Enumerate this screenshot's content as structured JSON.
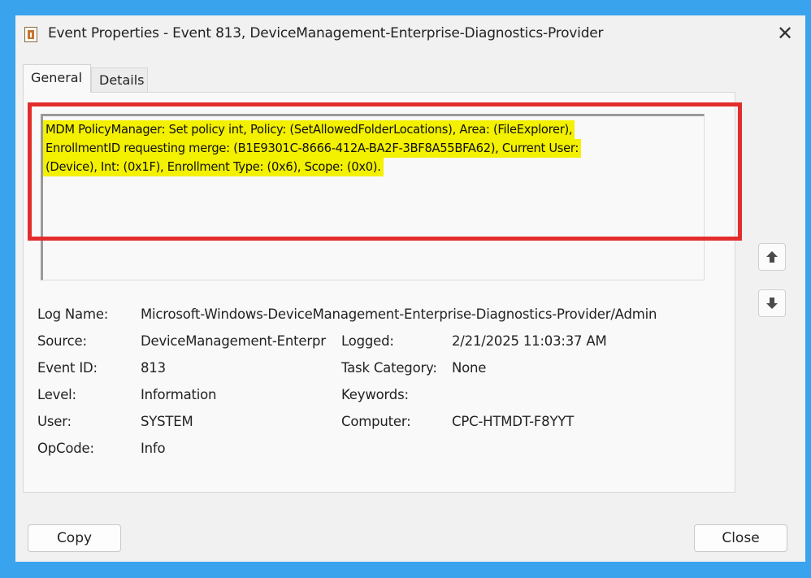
{
  "window": {
    "title": "Event Properties - Event 813, DeviceManagement-Enterprise-Diagnostics-Provider",
    "close_glyph": "✕",
    "icon": "event-viewer-icon"
  },
  "tabs": [
    {
      "label": "General",
      "selected": true
    },
    {
      "label": "Details",
      "selected": false
    }
  ],
  "description": {
    "line1": "MDM PolicyManager: Set policy int, Policy: (SetAllowedFolderLocations), Area: (FileExplorer),",
    "line2": "EnrollmentID requesting merge: (B1E9301C-8666-412A-BA2F-3BF8A55BFA62), Current User:",
    "line3": "(Device), Int: (0x1F), Enrollment Type: (0x6), Scope: (0x0).",
    "highlight_color": "#f3f000",
    "annotation_color": "#e32d2d"
  },
  "properties": {
    "log_name": {
      "label": "Log Name:",
      "value": "Microsoft-Windows-DeviceManagement-Enterprise-Diagnostics-Provider/Admin"
    },
    "source": {
      "label": "Source:",
      "value": "DeviceManagement-Enterpr"
    },
    "logged": {
      "label": "Logged:",
      "value": "2/21/2025 11:03:37 AM"
    },
    "event_id": {
      "label": "Event ID:",
      "value": "813"
    },
    "task_category": {
      "label": "Task Category:",
      "value": "None"
    },
    "level": {
      "label": "Level:",
      "value": "Information"
    },
    "keywords": {
      "label": "Keywords:",
      "value": ""
    },
    "user": {
      "label": "User:",
      "value": "SYSTEM"
    },
    "computer": {
      "label": "Computer:",
      "value": "CPC-HTMDT-F8YYT"
    },
    "opcode": {
      "label": "OpCode:",
      "value": "Info"
    }
  },
  "buttons": {
    "copy": "Copy",
    "close": "Close"
  },
  "colors": {
    "background": "#3aa3ee",
    "dialog": "#f1f1f1"
  }
}
